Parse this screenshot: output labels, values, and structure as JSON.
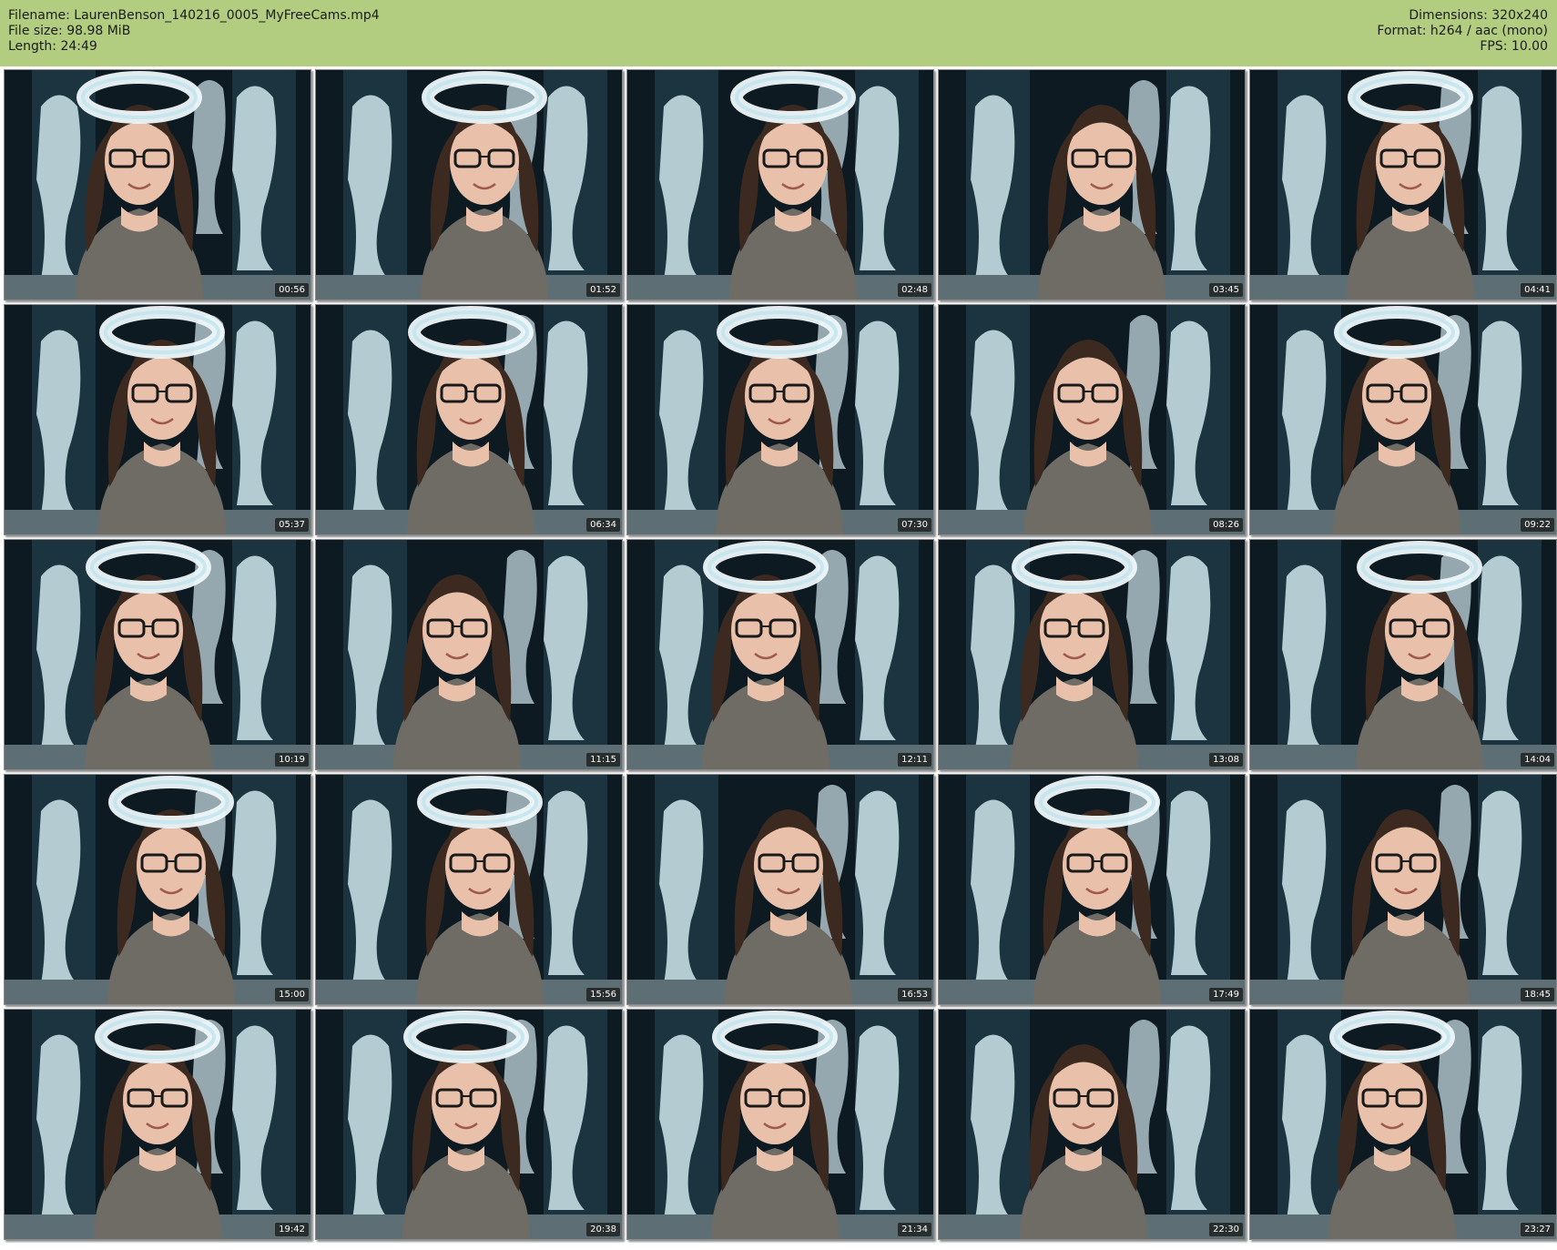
{
  "header": {
    "filename_line": "Filename: LaurenBenson_140216_0005_MyFreeCams.mp4",
    "filesize_line": "File size: 98.98 MiB",
    "length_line": "Length: 24:49",
    "dimensions_line": "Dimensions: 320x240",
    "format_line": "Format: h264 / aac (mono)",
    "fps_line": "FPS: 10.00"
  },
  "colors": {
    "header_bg": "#b2cc80",
    "backdrop": "#0e1a22",
    "poster": "#cfe6ec",
    "hair": "#3c2a20",
    "skin": "#e9c1ab",
    "top": "#6f6c66",
    "halo": "#eef8fb"
  },
  "thumbnails": [
    {
      "timestamp": "00:56",
      "halo": true
    },
    {
      "timestamp": "01:52",
      "halo": true
    },
    {
      "timestamp": "02:48",
      "halo": true
    },
    {
      "timestamp": "03:45",
      "halo": false
    },
    {
      "timestamp": "04:41",
      "halo": true
    },
    {
      "timestamp": "05:37",
      "halo": true
    },
    {
      "timestamp": "06:34",
      "halo": true
    },
    {
      "timestamp": "07:30",
      "halo": true
    },
    {
      "timestamp": "08:26",
      "halo": false
    },
    {
      "timestamp": "09:22",
      "halo": true
    },
    {
      "timestamp": "10:19",
      "halo": true
    },
    {
      "timestamp": "11:15",
      "halo": false
    },
    {
      "timestamp": "12:11",
      "halo": true
    },
    {
      "timestamp": "13:08",
      "halo": true
    },
    {
      "timestamp": "14:04",
      "halo": true
    },
    {
      "timestamp": "15:00",
      "halo": true
    },
    {
      "timestamp": "15:56",
      "halo": true
    },
    {
      "timestamp": "16:53",
      "halo": false
    },
    {
      "timestamp": "17:49",
      "halo": true
    },
    {
      "timestamp": "18:45",
      "halo": false
    },
    {
      "timestamp": "19:42",
      "halo": true
    },
    {
      "timestamp": "20:38",
      "halo": true
    },
    {
      "timestamp": "21:34",
      "halo": true
    },
    {
      "timestamp": "22:30",
      "halo": false
    },
    {
      "timestamp": "23:27",
      "halo": true
    }
  ]
}
